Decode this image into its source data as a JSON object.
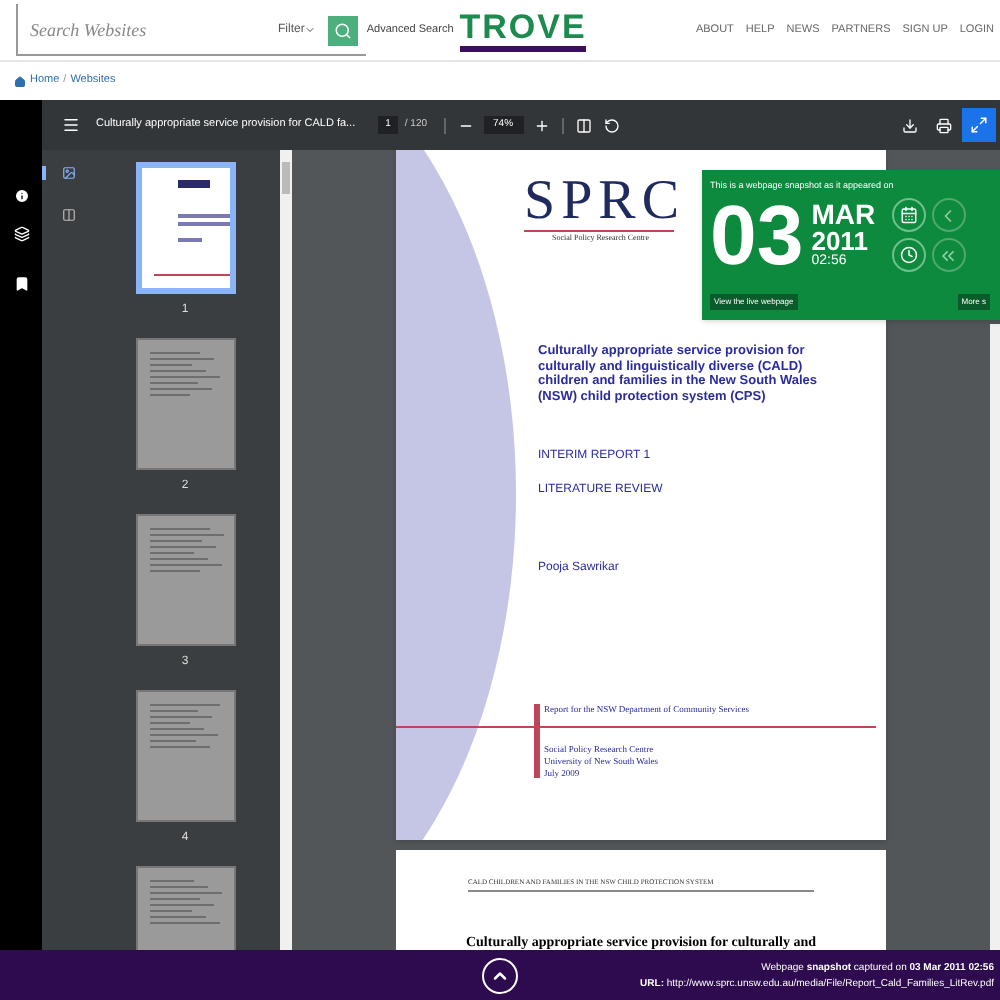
{
  "header": {
    "search": {
      "placeholder": "Search Websites"
    },
    "filter": "Filter",
    "advanced_search": "Advanced Search",
    "logo": "TROVE",
    "nav": [
      "ABOUT",
      "HELP",
      "NEWS",
      "PARTNERS",
      "SIGN UP",
      "LOGIN"
    ]
  },
  "breadcrumb": {
    "items": [
      "Home",
      "Websites"
    ],
    "separator": "/"
  },
  "viewer": {
    "title": "Culturally appropriate service provision for CALD fa...",
    "page": "1",
    "page_total": "/ 120",
    "zoom": "74%",
    "sidebar_tabs": [
      {
        "selected": true
      },
      {
        "selected": false
      }
    ],
    "thumbnails": [
      {
        "label": "1",
        "selected": true
      },
      {
        "label": "2",
        "selected": false
      },
      {
        "label": "3",
        "selected": false
      },
      {
        "label": "4",
        "selected": false
      },
      {
        "selected": false
      }
    ],
    "page_1": {
      "logo": "SPRC",
      "logo_subtitle": "Social Policy Research Centre",
      "title": "Culturally appropriate service provision for culturally and linguistically diverse (CALD) children and families in the New South Wales (NSW) child protection system (CPS)",
      "lines": [
        "INTERIM REPORT 1",
        "LITERATURE REVIEW"
      ],
      "author": "Pooja Sawrikar",
      "report_for": "Report for the NSW Department of Community Services",
      "org": [
        "Social Policy Research Centre",
        "University of New South Wales",
        "July 2009"
      ]
    },
    "page_2": {
      "running_head": "CALD CHILDREN AND FAMILIES IN THE NSW CHILD PROTECTION SYSTEM",
      "title": "Culturally appropriate service provision for culturally and"
    }
  },
  "snapshot": {
    "caption": "This is a webpage snapshot as it appeared on",
    "day": "03",
    "month": "MAR",
    "year": "2011",
    "time": "02:56",
    "live_button": "View the live webpage",
    "more_button": "More s"
  },
  "footer": {
    "captured": "Webpage **snapshot** captured on **03 Mar 2011 02:56**",
    "url": "**URL:** http://www.sprc.unsw.edu.au/media/File/Report_Cald_Families_LitRev.pdf"
  }
}
